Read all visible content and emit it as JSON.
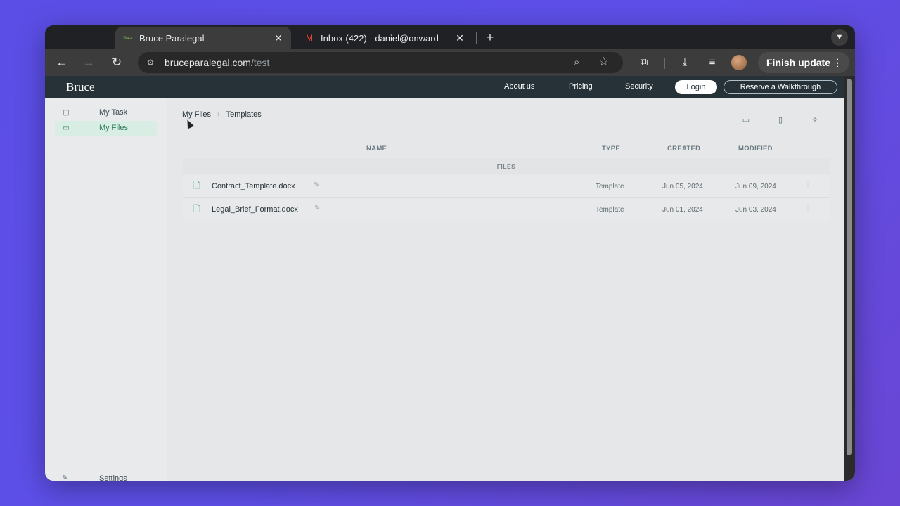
{
  "browser": {
    "tabs": [
      {
        "title": "Bruce Paralegal",
        "favicon_text": "Bruce",
        "active": true
      },
      {
        "title": "Inbox (422) - daniel@onward",
        "favicon": "gmail-icon",
        "active": false
      }
    ],
    "new_tab": "+",
    "url_host": "bruceparalegal.com",
    "url_path": "/test",
    "finish_update_label": "Finish update"
  },
  "site": {
    "brand": "Bruce",
    "nav": [
      "About us",
      "Pricing",
      "Security"
    ],
    "login_label": "Login",
    "walkthrough_label": "Reserve a Walkthrough"
  },
  "sidebar": {
    "items": [
      {
        "label": "My Task",
        "icon": "clipboard-icon",
        "active": false
      },
      {
        "label": "My Files",
        "icon": "folder-icon",
        "active": true
      }
    ],
    "settings_label": "Settings"
  },
  "main": {
    "breadcrumb": [
      "My Files",
      "Templates"
    ],
    "columns": {
      "name": "NAME",
      "type": "TYPE",
      "created": "CREATED",
      "modified": "MODIFIED"
    },
    "section_label": "FILES",
    "files": [
      {
        "name": "Contract_Template.docx",
        "type": "Template",
        "created": "Jun 05, 2024",
        "modified": "Jun 09, 2024"
      },
      {
        "name": "Legal_Brief_Format.docx",
        "type": "Template",
        "created": "Jun 01, 2024",
        "modified": "Jun 03, 2024"
      }
    ]
  },
  "colors": {
    "accent_green": "#2e7d5b",
    "header_bg": "#263238",
    "background_purple": "#5b4ee6"
  }
}
